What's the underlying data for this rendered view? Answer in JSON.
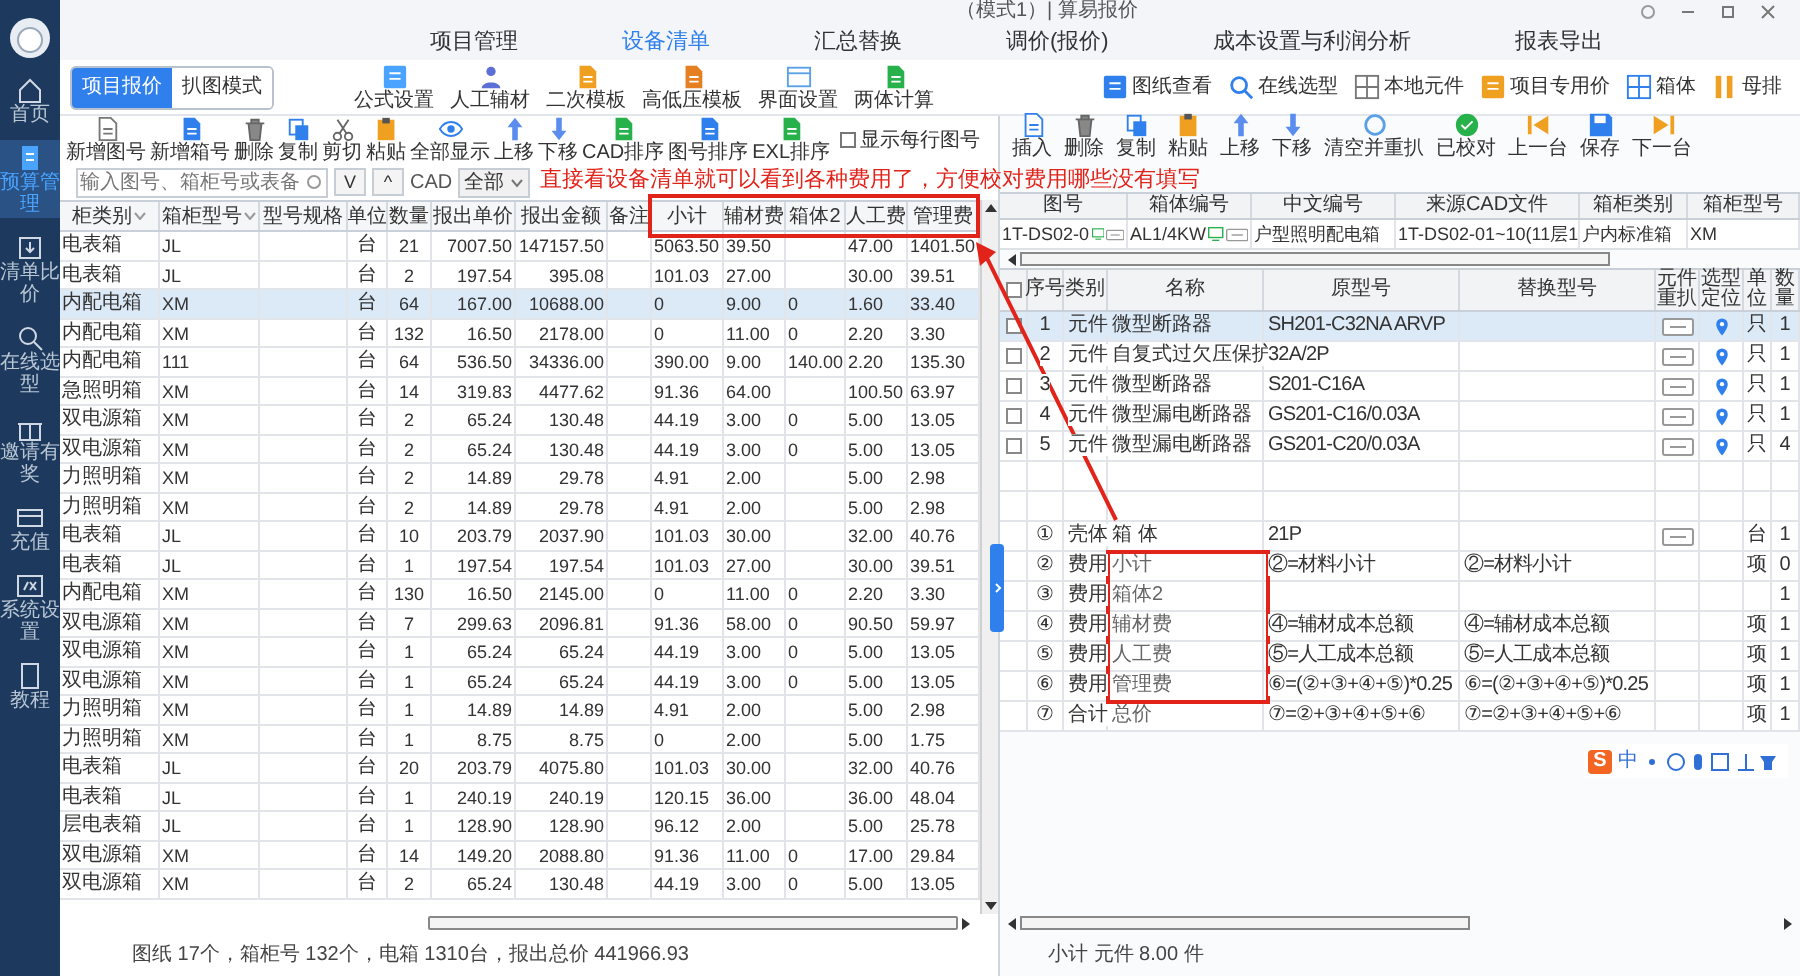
{
  "window": {
    "title": "（模式1）| 算易报价"
  },
  "sidebar": {
    "items": [
      {
        "label": "首页",
        "selected": false
      },
      {
        "label": "预算管理",
        "selected": true
      },
      {
        "label": "清单比价",
        "selected": false
      },
      {
        "label": "在线选型",
        "selected": false
      },
      {
        "label": "邀请有奖",
        "selected": false
      },
      {
        "label": "充值",
        "selected": false
      },
      {
        "label": "系统设置",
        "selected": false
      },
      {
        "label": "教程",
        "selected": false
      }
    ]
  },
  "menu_tabs": [
    {
      "label": "项目管理",
      "selected": false
    },
    {
      "label": "设备清单",
      "selected": true
    },
    {
      "label": "汇总替换",
      "selected": false
    },
    {
      "label": "调价(报价)",
      "selected": false
    },
    {
      "label": "成本设置与利润分析",
      "selected": false
    },
    {
      "label": "报表导出",
      "selected": false
    }
  ],
  "mode_toggle": [
    {
      "label": "项目报价",
      "selected": true
    },
    {
      "label": "扒图模式",
      "selected": false
    }
  ],
  "main_toolbar": [
    "公式设置",
    "人工辅材",
    "二次模板",
    "高低压模板",
    "界面设置",
    "两体计算"
  ],
  "side_toolbar": [
    "图纸查看",
    "在线选型",
    "本地元件",
    "项目专用价",
    "箱体",
    "母排"
  ],
  "list_toolbar": [
    "新增图号",
    "新增箱号",
    "删除",
    "复制",
    "剪切",
    "粘贴",
    "全部显示",
    "上移",
    "下移",
    "CAD排序",
    "图号排序",
    "EXL排序"
  ],
  "show_drawing_no": {
    "label": "显示每行图号",
    "checked": false
  },
  "filter": {
    "placeholder": "输入图号、箱柜号或表备",
    "down": "V",
    "up": "^",
    "cad_label": "CAD",
    "cad_value": "全部"
  },
  "annotation": "直接看设备清单就可以看到各种费用了，方便校对费用哪些没有填写",
  "cabinet_table": {
    "columns": [
      "柜类别",
      "箱柜型号",
      "型号规格",
      "单位",
      "数量",
      "报出单价",
      "报出金额",
      "备注",
      "小计",
      "辅材费",
      "箱体2",
      "人工费",
      "管理费"
    ],
    "rows": [
      {
        "category": "电表箱",
        "model": "JL",
        "unit": "台",
        "qty": "21",
        "price": "7007.50",
        "amount": "147157.50",
        "subtotal": "5063.50",
        "aux": "39.50",
        "labor": "47.00",
        "mgmt": "1401.50",
        "selected": false
      },
      {
        "category": "电表箱",
        "model": "JL",
        "unit": "台",
        "qty": "2",
        "price": "197.54",
        "amount": "395.08",
        "subtotal": "101.03",
        "aux": "27.00",
        "labor": "30.00",
        "mgmt": "39.51",
        "selected": false
      },
      {
        "category": "内配电箱",
        "model": "XM",
        "unit": "台",
        "qty": "64",
        "price": "167.00",
        "amount": "10688.00",
        "subtotal": "0",
        "aux": "9.00",
        "box2": "0",
        "labor": "1.60",
        "mgmt": "33.40",
        "selected": true
      },
      {
        "category": "内配电箱",
        "model": "XM",
        "unit": "台",
        "qty": "132",
        "price": "16.50",
        "amount": "2178.00",
        "subtotal": "0",
        "aux": "11.00",
        "box2": "0",
        "labor": "2.20",
        "mgmt": "3.30",
        "selected": false
      },
      {
        "category": "内配电箱",
        "model": "111",
        "unit": "台",
        "qty": "64",
        "price": "536.50",
        "amount": "34336.00",
        "subtotal": "390.00",
        "aux": "9.00",
        "box2": "140.00",
        "labor": "2.20",
        "mgmt": "135.30",
        "selected": false
      },
      {
        "category": "急照明箱",
        "model": "XM",
        "unit": "台",
        "qty": "14",
        "price": "319.83",
        "amount": "4477.62",
        "subtotal": "91.36",
        "aux": "64.00",
        "labor": "100.50",
        "mgmt": "63.97",
        "selected": false
      },
      {
        "category": "双电源箱",
        "model": "XM",
        "unit": "台",
        "qty": "2",
        "price": "65.24",
        "amount": "130.48",
        "subtotal": "44.19",
        "aux": "3.00",
        "box2": "0",
        "labor": "5.00",
        "mgmt": "13.05",
        "selected": false
      },
      {
        "category": "双电源箱",
        "model": "XM",
        "unit": "台",
        "qty": "2",
        "price": "65.24",
        "amount": "130.48",
        "subtotal": "44.19",
        "aux": "3.00",
        "box2": "0",
        "labor": "5.00",
        "mgmt": "13.05",
        "selected": false
      },
      {
        "category": "力照明箱",
        "model": "XM",
        "unit": "台",
        "qty": "2",
        "price": "14.89",
        "amount": "29.78",
        "subtotal": "4.91",
        "aux": "2.00",
        "labor": "5.00",
        "mgmt": "2.98",
        "selected": false
      },
      {
        "category": "力照明箱",
        "model": "XM",
        "unit": "台",
        "qty": "2",
        "price": "14.89",
        "amount": "29.78",
        "subtotal": "4.91",
        "aux": "2.00",
        "labor": "5.00",
        "mgmt": "2.98",
        "selected": false
      },
      {
        "category": "电表箱",
        "model": "JL",
        "unit": "台",
        "qty": "10",
        "price": "203.79",
        "amount": "2037.90",
        "subtotal": "101.03",
        "aux": "30.00",
        "labor": "32.00",
        "mgmt": "40.76",
        "selected": false
      },
      {
        "category": "电表箱",
        "model": "JL",
        "unit": "台",
        "qty": "1",
        "price": "197.54",
        "amount": "197.54",
        "subtotal": "101.03",
        "aux": "27.00",
        "labor": "30.00",
        "mgmt": "39.51",
        "selected": false
      },
      {
        "category": "内配电箱",
        "model": "XM",
        "unit": "台",
        "qty": "130",
        "price": "16.50",
        "amount": "2145.00",
        "subtotal": "0",
        "aux": "11.00",
        "box2": "0",
        "labor": "2.20",
        "mgmt": "3.30",
        "selected": false
      },
      {
        "category": "双电源箱",
        "model": "XM",
        "unit": "台",
        "qty": "7",
        "price": "299.63",
        "amount": "2096.81",
        "subtotal": "91.36",
        "aux": "58.00",
        "box2": "0",
        "labor": "90.50",
        "mgmt": "59.97",
        "selected": false
      },
      {
        "category": "双电源箱",
        "model": "XM",
        "unit": "台",
        "qty": "1",
        "price": "65.24",
        "amount": "65.24",
        "subtotal": "44.19",
        "aux": "3.00",
        "box2": "0",
        "labor": "5.00",
        "mgmt": "13.05",
        "selected": false
      },
      {
        "category": "双电源箱",
        "model": "XM",
        "unit": "台",
        "qty": "1",
        "price": "65.24",
        "amount": "65.24",
        "subtotal": "44.19",
        "aux": "3.00",
        "box2": "0",
        "labor": "5.00",
        "mgmt": "13.05",
        "selected": false
      },
      {
        "category": "力照明箱",
        "model": "XM",
        "unit": "台",
        "qty": "1",
        "price": "14.89",
        "amount": "14.89",
        "subtotal": "4.91",
        "aux": "2.00",
        "labor": "5.00",
        "mgmt": "2.98",
        "selected": false
      },
      {
        "category": "力照明箱",
        "model": "XM",
        "unit": "台",
        "qty": "1",
        "price": "8.75",
        "amount": "8.75",
        "subtotal": "0",
        "aux": "2.00",
        "labor": "5.00",
        "mgmt": "1.75",
        "selected": false
      },
      {
        "category": "电表箱",
        "model": "JL",
        "unit": "台",
        "qty": "20",
        "price": "203.79",
        "amount": "4075.80",
        "subtotal": "101.03",
        "aux": "30.00",
        "labor": "32.00",
        "mgmt": "40.76",
        "selected": false
      },
      {
        "category": "电表箱",
        "model": "JL",
        "unit": "台",
        "qty": "1",
        "price": "240.19",
        "amount": "240.19",
        "subtotal": "120.15",
        "aux": "36.00",
        "labor": "36.00",
        "mgmt": "48.04",
        "selected": false
      },
      {
        "category": "层电表箱",
        "model": "JL",
        "unit": "台",
        "qty": "1",
        "price": "128.90",
        "amount": "128.90",
        "subtotal": "96.12",
        "aux": "2.00",
        "labor": "5.00",
        "mgmt": "25.78",
        "selected": false
      },
      {
        "category": "双电源箱",
        "model": "XM",
        "unit": "台",
        "qty": "14",
        "price": "149.20",
        "amount": "2088.80",
        "subtotal": "91.36",
        "aux": "11.00",
        "box2": "0",
        "labor": "17.00",
        "mgmt": "29.84",
        "selected": false
      },
      {
        "category": "双电源箱",
        "model": "XM",
        "unit": "台",
        "qty": "2",
        "price": "65.24",
        "amount": "130.48",
        "subtotal": "44.19",
        "aux": "3.00",
        "box2": "0",
        "labor": "5.00",
        "mgmt": "13.05",
        "selected": false
      }
    ]
  },
  "status_left": "图纸 17个，箱柜号 132个，电箱 1310台，报出总价 441966.93",
  "detail_toolbar": [
    "插入",
    "删除",
    "复制",
    "粘贴",
    "上移",
    "下移",
    "清空并重扒",
    "已校对",
    "上一台",
    "保存",
    "下一台"
  ],
  "box_info": {
    "columns": [
      "图号",
      "箱体编号",
      "中文编号",
      "来源CAD文件",
      "箱柜类别",
      "箱柜型号"
    ],
    "row": [
      "1T-DS02-0",
      "AL1/4KW",
      "户型照明配电箱",
      "1T-DS02-01~10(11层1",
      "户内标准箱",
      "XM"
    ]
  },
  "parts_table": {
    "select_all_checked": false,
    "columns": [
      "序号",
      "类别",
      "名称",
      "原型号",
      "替换型号",
      "元件重扒",
      "选型定位",
      "单位",
      "数量"
    ],
    "rows": [
      {
        "kind": "item",
        "checked": false,
        "selected": true,
        "no": "1",
        "type": "元件",
        "name": "微型断路器",
        "model": "SH201-C32NA ARVP",
        "unit": "只",
        "qty": "1"
      },
      {
        "kind": "item",
        "checked": false,
        "selected": false,
        "no": "2",
        "type": "元件",
        "name": "自复式过欠压保护",
        "model": "32A/2P",
        "unit": "只",
        "qty": "1"
      },
      {
        "kind": "item",
        "checked": false,
        "selected": false,
        "no": "3",
        "type": "元件",
        "name": "微型断路器",
        "model": "S201-C16A",
        "unit": "只",
        "qty": "1"
      },
      {
        "kind": "item",
        "checked": false,
        "selected": false,
        "no": "4",
        "type": "元件",
        "name": "微型漏电断路器",
        "model": "GS201-C16/0.03A",
        "unit": "只",
        "qty": "1"
      },
      {
        "kind": "item",
        "checked": false,
        "selected": false,
        "no": "5",
        "type": "元件",
        "name": "微型漏电断路器",
        "model": "GS201-C20/0.03A",
        "unit": "只",
        "qty": "4"
      },
      {
        "kind": "blank"
      },
      {
        "kind": "blank"
      },
      {
        "kind": "shell",
        "no": "①",
        "type": "壳体",
        "name": "箱 体",
        "model": "21P",
        "unit": "台",
        "qty": "1"
      },
      {
        "kind": "fee",
        "no": "②",
        "type": "费用",
        "name": "小计",
        "model": "②=材料小计",
        "replace": "②=材料小计",
        "unit": "项",
        "qty": "0"
      },
      {
        "kind": "fee",
        "no": "③",
        "type": "费用",
        "name": "箱体2",
        "qty": "1"
      },
      {
        "kind": "fee",
        "no": "④",
        "type": "费用",
        "name": "辅材费",
        "model": "④=辅材成本总额",
        "replace": "④=辅材成本总额",
        "unit": "项",
        "qty": "1"
      },
      {
        "kind": "fee",
        "no": "⑤",
        "type": "费用",
        "name": "人工费",
        "model": "⑤=人工成本总额",
        "replace": "⑤=人工成本总额",
        "unit": "项",
        "qty": "1"
      },
      {
        "kind": "fee",
        "no": "⑥",
        "type": "费用",
        "name": "管理费",
        "model": "⑥=(②+③+④+⑤)*0.25",
        "replace": "⑥=(②+③+④+⑤)*0.25",
        "unit": "项",
        "qty": "1"
      },
      {
        "kind": "fee",
        "no": "⑦",
        "type": "合计",
        "name": "总价",
        "model": "⑦=②+③+④+⑤+⑥",
        "replace": "⑦=②+③+④+⑤+⑥",
        "unit": "项",
        "qty": "1"
      }
    ]
  },
  "ime_bar": {
    "logo": "S",
    "mode": "中"
  },
  "status_right": "小计 元件 8.00 件"
}
